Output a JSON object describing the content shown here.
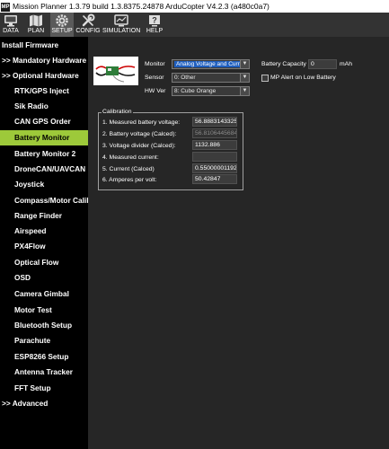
{
  "window": {
    "title": "Mission Planner 1.3.79 build 1.3.8375.24878 ArduCopter V4.2.3 (a480c0a7)"
  },
  "toolbar": {
    "items": [
      {
        "label": "DATA",
        "icon": "data-monitor-icon"
      },
      {
        "label": "PLAN",
        "icon": "plan-map-icon"
      },
      {
        "label": "SETUP",
        "icon": "setup-gear-icon"
      },
      {
        "label": "CONFIG",
        "icon": "config-wrench-icon"
      },
      {
        "label": "SIMULATION",
        "icon": "simulation-monitor-icon"
      },
      {
        "label": "HELP",
        "icon": "help-icon"
      }
    ],
    "active": "SETUP"
  },
  "sidebar": {
    "items": [
      {
        "label": "Install Firmware"
      },
      {
        "label": ">> Mandatory Hardware"
      },
      {
        "label": ">> Optional Hardware"
      },
      {
        "label": "RTK/GPS Inject"
      },
      {
        "label": "Sik Radio"
      },
      {
        "label": "CAN GPS Order"
      },
      {
        "label": "Battery Monitor"
      },
      {
        "label": "Battery Monitor 2"
      },
      {
        "label": "DroneCAN/UAVCAN"
      },
      {
        "label": "Joystick"
      },
      {
        "label": "Compass/Motor Calib"
      },
      {
        "label": "Range Finder"
      },
      {
        "label": "Airspeed"
      },
      {
        "label": "PX4Flow"
      },
      {
        "label": "Optical Flow"
      },
      {
        "label": "OSD"
      },
      {
        "label": "Camera Gimbal"
      },
      {
        "label": "Motor Test"
      },
      {
        "label": "Bluetooth Setup"
      },
      {
        "label": "Parachute"
      },
      {
        "label": "ESP8266 Setup"
      },
      {
        "label": "Antenna Tracker"
      },
      {
        "label": "FFT Setup"
      },
      {
        "label": ">> Advanced"
      }
    ],
    "active": "Battery Monitor"
  },
  "battery": {
    "monitor_label": "Monitor",
    "monitor_value": "Analog Voltage and Current",
    "sensor_label": "Sensor",
    "sensor_value": "0: Other",
    "hwver_label": "HW Ver",
    "hwver_value": "8: Cube Orange",
    "capacity_label": "Battery Capacity",
    "capacity_value": "0",
    "capacity_unit": "mAh",
    "alert_label": "MP Alert on Low Battery",
    "alert_checked": false
  },
  "calibration": {
    "title": "Calibration",
    "rows": [
      {
        "label": "1. Measured battery voltage:",
        "value": "56.8883143325"
      },
      {
        "label": "2. Battery voltage (Calced):",
        "value": "56.8106445684"
      },
      {
        "label": "3. Voltage divider (Calced):",
        "value": "1132.886"
      },
      {
        "label": "4. Measured current:",
        "value": ""
      },
      {
        "label": "5. Current (Calced)",
        "value": "0.550000011921"
      },
      {
        "label": "6. Amperes per volt:",
        "value": "50.42847"
      }
    ]
  },
  "colors": {
    "sidebar_active": "#9dc93a",
    "selection": "#1f5fbf",
    "background": "#262626"
  }
}
